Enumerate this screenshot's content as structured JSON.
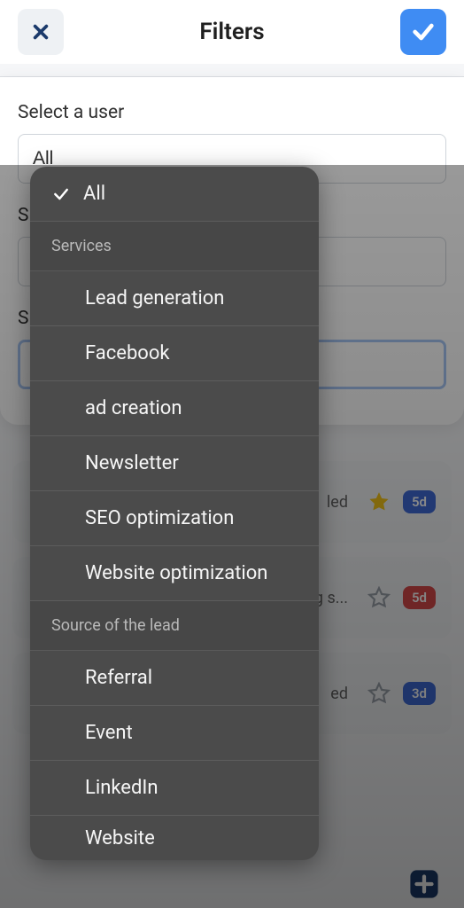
{
  "header": {
    "title": "Filters"
  },
  "form": {
    "user_label": "Select a user",
    "user_value": "All",
    "second_label_initial": "S",
    "third_label_initial": "S"
  },
  "dropdown": {
    "selected": "All",
    "groups": [
      {
        "header": "Services",
        "items": [
          "Lead generation",
          "Facebook",
          "ad creation",
          "Newsletter",
          "SEO optimization",
          "Website optimization"
        ]
      },
      {
        "header": "Source of the lead",
        "items": [
          "Referral",
          "Event",
          "LinkedIn",
          "Website"
        ]
      }
    ]
  },
  "bg_rows": [
    {
      "text": "led",
      "star": "filled",
      "badge": "5d",
      "badge_color": "blue"
    },
    {
      "text": "g s...",
      "star": "outline",
      "badge": "5d",
      "badge_color": "red"
    },
    {
      "text": "ed",
      "star": "outline",
      "badge": "3d",
      "badge_color": "blue"
    }
  ]
}
